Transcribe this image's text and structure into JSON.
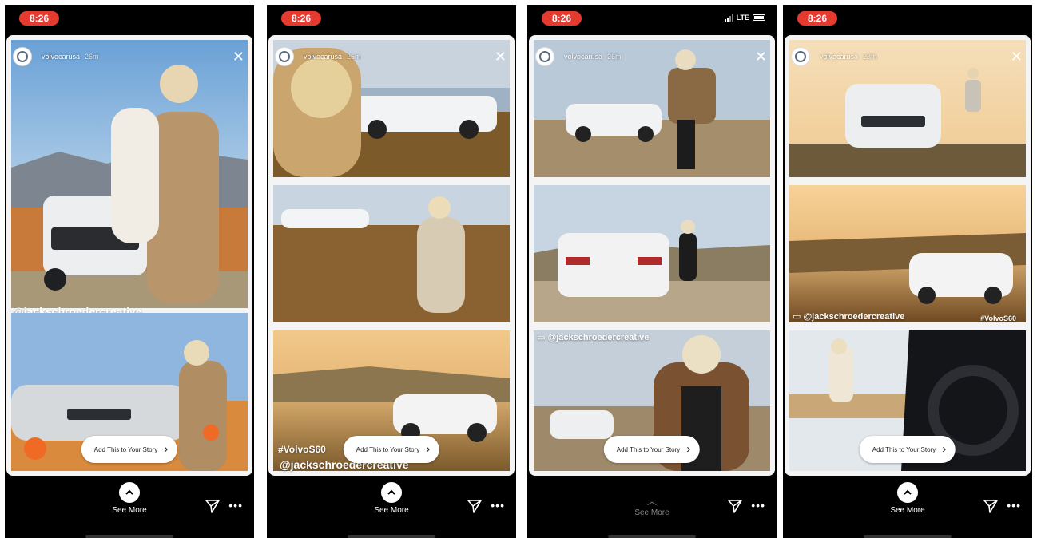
{
  "colors": {
    "time_pill": "#e53a2f",
    "background": "#000000"
  },
  "phones": [
    {
      "time": "8:26",
      "network": "",
      "username": "volvocarusa",
      "time_ago": "26m",
      "handle": "@jackschroedercreative",
      "hashtag_bottom": "",
      "add_story_label": "Add This to Your Story",
      "see_more_label": "See More"
    },
    {
      "time": "8:26",
      "network": "",
      "username": "volvocarusa",
      "time_ago": "25m",
      "hashtag": "#VolvoS60",
      "handle": "@jackschroedercreative",
      "add_story_label": "Add This to Your Story",
      "see_more_label": "See More"
    },
    {
      "time": "8:26",
      "network": "LTE",
      "username": "volvocarusa",
      "time_ago": "26m",
      "handle": "@jackschroedercreative",
      "add_story_label": "Add This to Your Story",
      "see_more_label": "See More"
    },
    {
      "time": "8:26",
      "network": "",
      "username": "volvocarusa",
      "time_ago": "23m",
      "handle": "@jackschroedercreative",
      "hashtag": "#VolvoS60",
      "add_story_label": "Add This to Your Story",
      "see_more_label": "See More"
    }
  ]
}
